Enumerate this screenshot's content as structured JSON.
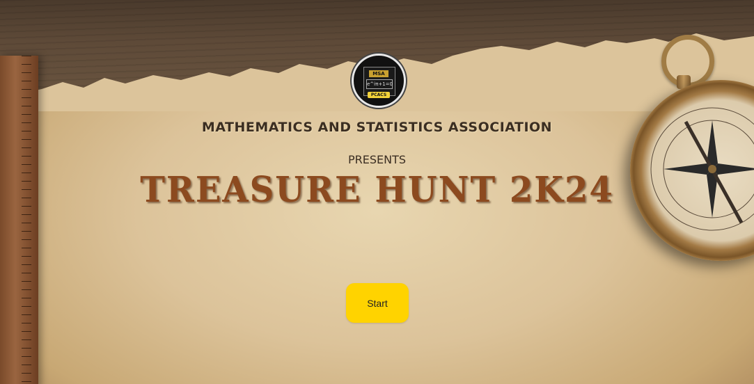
{
  "header": {
    "logo": {
      "ring_text": "Mathematics & Statistics Association",
      "mark_text": "MSA",
      "formula_text": "e^iπ+1=0",
      "badge_text": "PCACS"
    },
    "association_name": "MATHEMATICS AND STATISTICS ASSOCIATION",
    "presents_label": "PRESENTS",
    "event_title": "TREASURE HUNT 2K24"
  },
  "actions": {
    "start_label": "Start"
  },
  "colors": {
    "start_button": "#ffd300",
    "title": "#8c4a1f",
    "text_dark": "#3b2e22"
  },
  "decor": {
    "icons": [
      "compass-icon",
      "ruler-icon",
      "logo-emblem"
    ]
  }
}
